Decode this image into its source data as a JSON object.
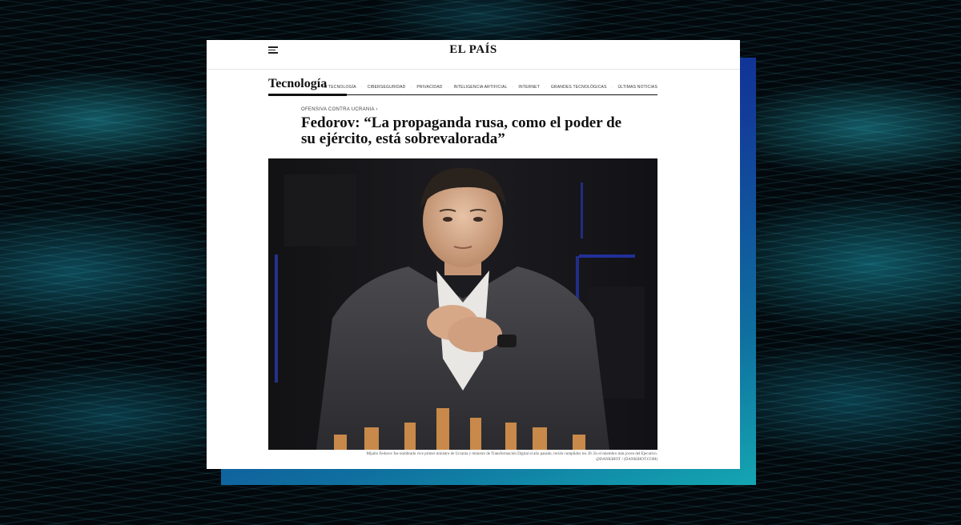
{
  "header": {
    "logo": "EL PAÍS",
    "menu_icon": "hamburger-menu-icon"
  },
  "section": {
    "title": "Tecnología",
    "nav": [
      "TU TECNOLOGÍA",
      "CIBERSEGURIDAD",
      "PRIVACIDAD",
      "INTELIGENCIA ARTIFICIAL",
      "INTERNET",
      "GRANDES TECNOLÓGICAS",
      "ÚLTIMAS NOTICIAS"
    ]
  },
  "article": {
    "kicker": "OFENSIVA CONTRA UCRANIA ›",
    "headline": "Fedorov: “La propaganda rusa, como el poder de su ejército, está sobrevalorada”",
    "caption": "Mijailo Fedorov fue nombrado vice primer ministro de Ucrania y ministro de Transformación Digital el año pasado, recién cumplidos los 30. Es el miembro más joven del Ejecutivo.",
    "credit": "@DANKIHOT / (DANKIHOT.COM)"
  },
  "colors": {
    "accent_frame_top": "#0d1b8a",
    "accent_frame_bottom": "#14a6b2",
    "background": "#02080c"
  }
}
